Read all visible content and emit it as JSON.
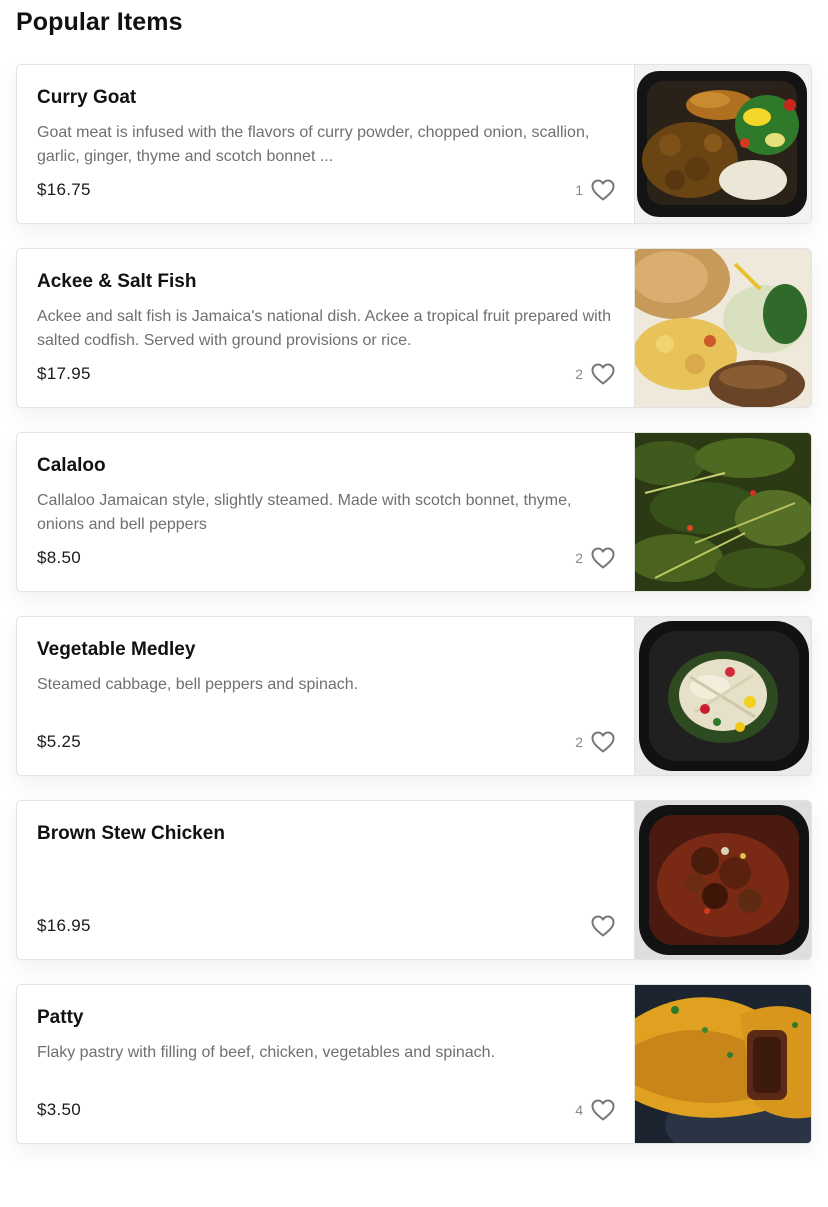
{
  "section": {
    "title": "Popular Items"
  },
  "items": [
    {
      "name": "Curry Goat",
      "description": "Goat meat is infused with the flavors of curry powder, chopped onion, scallion, garlic, ginger, thyme and scotch bonnet ...",
      "price": "$16.75",
      "likes": "1",
      "photo": "curry goat in black takeout container with plantain, rice and vegetables"
    },
    {
      "name": "Ackee & Salt Fish",
      "description": "Ackee and salt fish is Jamaica's national dish. Ackee a tropical fruit prepared with salted codfish. Served with ground provisions or rice.",
      "price": "$17.95",
      "likes": "2",
      "photo": "ackee and salt fish plate with fried dumpling, cabbage and greens"
    },
    {
      "name": "Calaloo",
      "description": "Callaloo Jamaican style, slightly steamed. Made with scotch bonnet, thyme, onions and bell peppers",
      "price": "$8.50",
      "likes": "2",
      "photo": "steamed callaloo greens"
    },
    {
      "name": "Vegetable Medley",
      "description": "Steamed cabbage, bell peppers and spinach.",
      "price": "$5.25",
      "likes": "2",
      "photo": "steamed cabbage with peppers in black bowl"
    },
    {
      "name": "Brown Stew Chicken",
      "description": "",
      "price": "$16.95",
      "likes": "",
      "photo": "brown stew chicken in black bowl"
    },
    {
      "name": "Patty",
      "description": "Flaky pastry with filling of beef, chicken, vegetables and spinach.",
      "price": "$3.50",
      "likes": "4",
      "photo": "golden jamaican patties cut open"
    }
  ],
  "icons": {
    "favorite": "heart-outline-icon"
  },
  "colors": {
    "text": "#111111",
    "muted": "#6f6f6f",
    "count": "#8a8a8a",
    "border": "#e3e3e3",
    "heart": "#777777"
  }
}
